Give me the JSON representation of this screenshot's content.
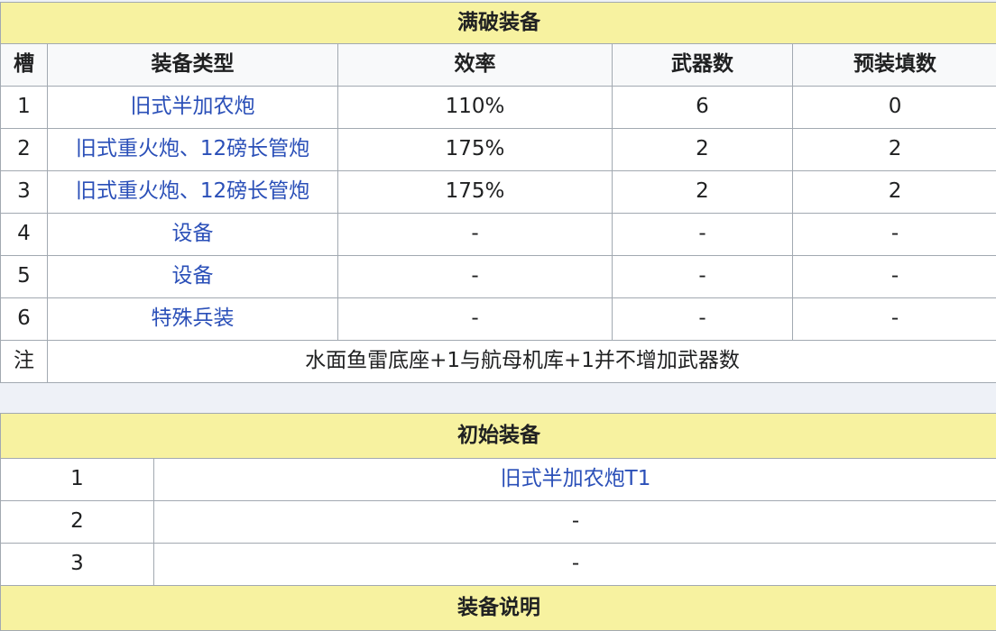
{
  "full_table": {
    "title": "满破装备",
    "columns": [
      "槽",
      "装备类型",
      "效率",
      "武器数",
      "预装填数"
    ],
    "rows": [
      {
        "slot": "1",
        "type": "旧式半加农炮",
        "efficiency": "110%",
        "weapons": "6",
        "preload": "0"
      },
      {
        "slot": "2",
        "type": "旧式重火炮、12磅长管炮",
        "efficiency": "175%",
        "weapons": "2",
        "preload": "2"
      },
      {
        "slot": "3",
        "type": "旧式重火炮、12磅长管炮",
        "efficiency": "175%",
        "weapons": "2",
        "preload": "2"
      },
      {
        "slot": "4",
        "type": "设备",
        "efficiency": "-",
        "weapons": "-",
        "preload": "-"
      },
      {
        "slot": "5",
        "type": "设备",
        "efficiency": "-",
        "weapons": "-",
        "preload": "-"
      },
      {
        "slot": "6",
        "type": "特殊兵装",
        "efficiency": "-",
        "weapons": "-",
        "preload": "-"
      }
    ],
    "note_label": "注",
    "note_text": "水面鱼雷底座+1与航母机库+1并不增加武器数"
  },
  "initial_table": {
    "title": "初始装备",
    "rows": [
      {
        "slot": "1",
        "equipment": "旧式半加农炮T1"
      },
      {
        "slot": "2",
        "equipment": "-"
      },
      {
        "slot": "3",
        "equipment": "-"
      }
    ],
    "description_title": "装备说明"
  },
  "colors": {
    "header_bg": "#f7f2a0",
    "link": "#2a4fb8",
    "border": "#a2a9b1"
  }
}
